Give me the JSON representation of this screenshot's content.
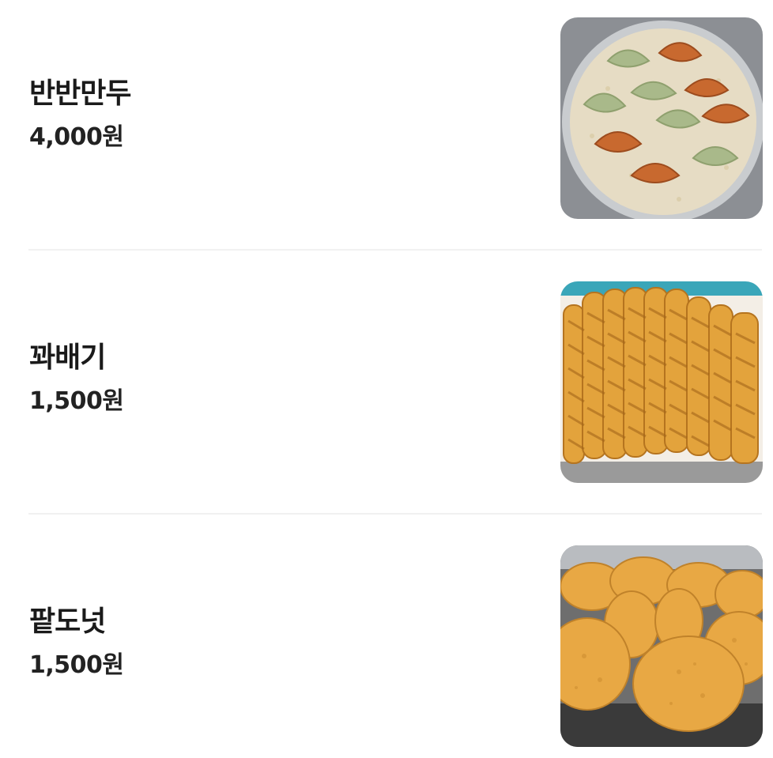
{
  "menu": {
    "items": [
      {
        "name": "반반만두",
        "price": "4,000원",
        "image_icon": "dumpling-photo"
      },
      {
        "name": "꽈배기",
        "price": "1,500원",
        "image_icon": "twisted-donut-photo"
      },
      {
        "name": "팥도넛",
        "price": "1,500원",
        "image_icon": "red-bean-donut-photo"
      }
    ]
  },
  "colors": {
    "text": "#1a1a1a",
    "divider": "#f1f1f1",
    "fried_gold": "#e3a33c",
    "dumpling_green": "#a9b98a",
    "dumpling_orange": "#c8692f"
  }
}
